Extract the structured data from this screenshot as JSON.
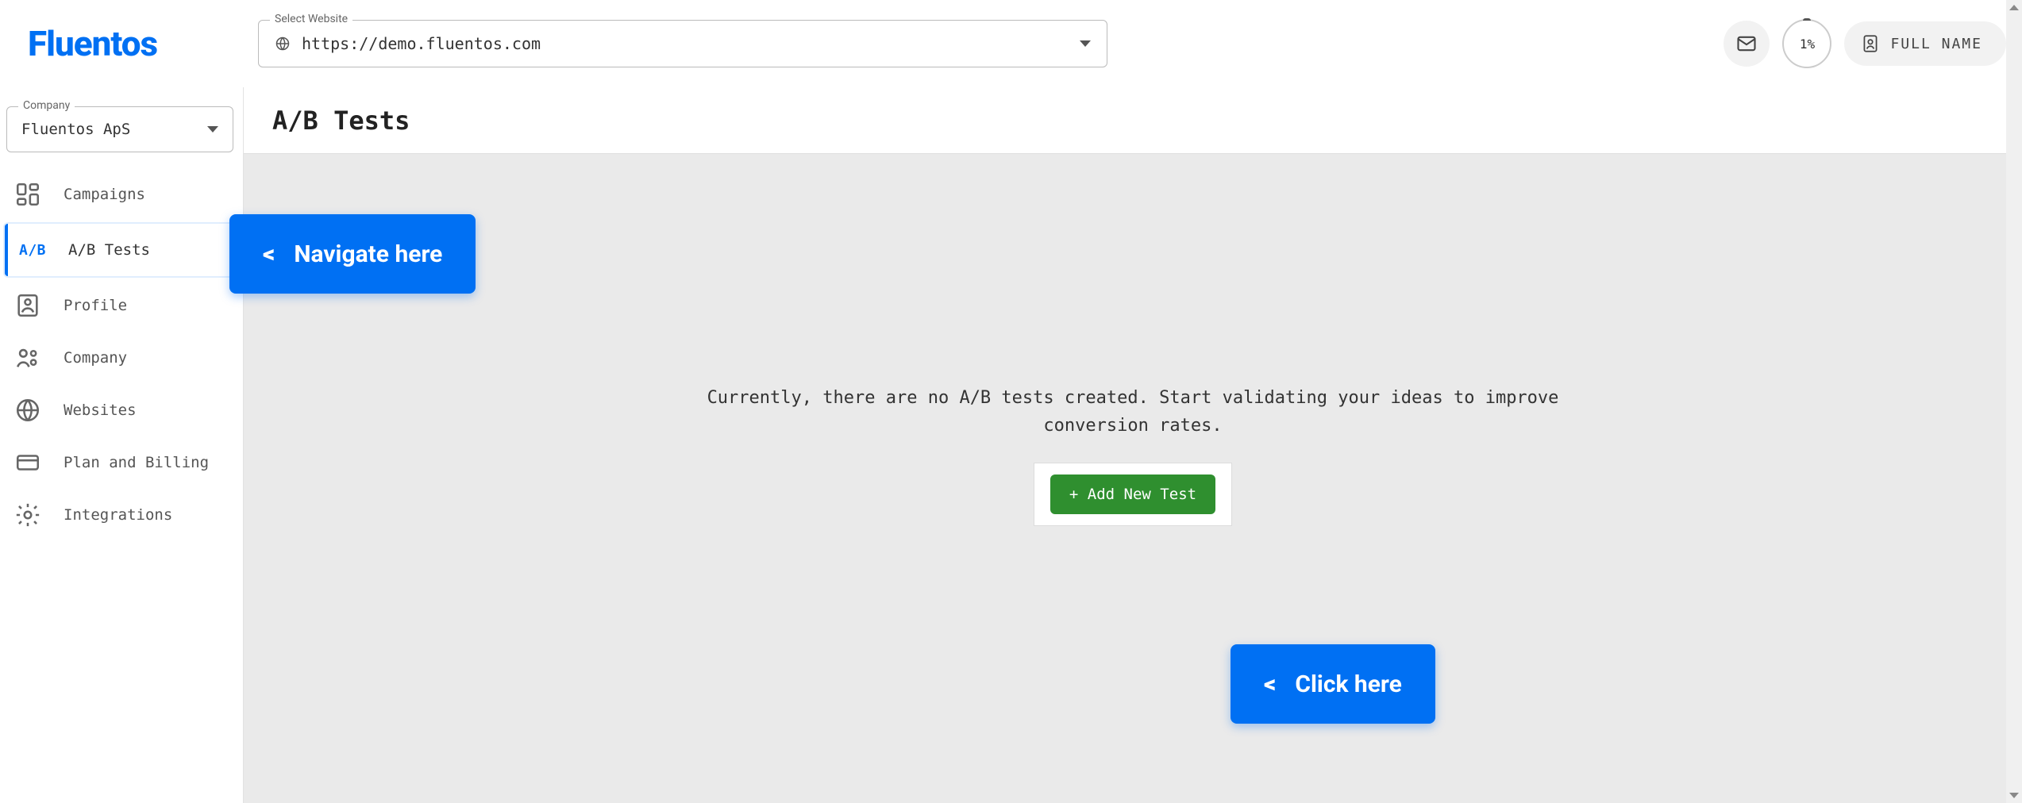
{
  "brand": "Fluentos",
  "website_selector": {
    "label": "Select Website",
    "value": "https://demo.fluentos.com"
  },
  "header": {
    "progress_badge": "1%",
    "user_name": "FULL NAME"
  },
  "company_selector": {
    "label": "Company",
    "value": "Fluentos ApS"
  },
  "sidebar": {
    "items": [
      {
        "label": "Campaigns"
      },
      {
        "label": "A/B Tests",
        "active": true
      },
      {
        "label": "Profile"
      },
      {
        "label": "Company"
      },
      {
        "label": "Websites"
      },
      {
        "label": "Plan and Billing"
      },
      {
        "label": "Integrations"
      }
    ]
  },
  "page": {
    "title": "A/B Tests",
    "empty_text": "Currently, there are no A/B tests created. Start validating your ideas to improve conversion rates.",
    "add_button": "+ Add New Test"
  },
  "callouts": {
    "navigate": "Navigate here",
    "click": "Click here"
  }
}
